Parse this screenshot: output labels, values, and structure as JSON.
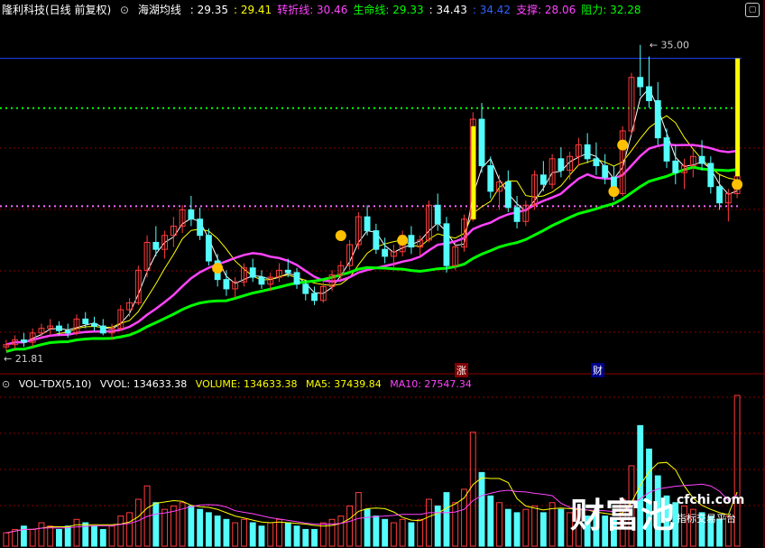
{
  "header": {
    "stock_title": "隆利科技(日线 前复权)",
    "indicator_name": "海湖均线",
    "values": [
      {
        "label": "",
        "value": "29.35",
        "color": "#ffffff"
      },
      {
        "label": "",
        "value": "29.41",
        "color": "#ffff00"
      },
      {
        "label": "转折线",
        "value": "30.46",
        "color": "#ff44ff"
      },
      {
        "label": "生命线",
        "value": "29.33",
        "color": "#00ff00"
      },
      {
        "label": "",
        "value": "34.43",
        "color": "#ffffff"
      },
      {
        "label": "",
        "value": "34.42",
        "color": "#3060ff"
      },
      {
        "label": "支撑",
        "value": "28.06",
        "color": "#ff44ff"
      },
      {
        "label": "阻力",
        "value": "32.28",
        "color": "#00ff00"
      }
    ]
  },
  "volume_header": {
    "name": "VOL-TDX(5,10)",
    "vvol": "VVOL: 134633.38",
    "volume": "VOLUME: 134633.38",
    "ma5": "MA5: 37439.84",
    "ma10": "MA10: 27547.34"
  },
  "annotations": {
    "high_label": "35.00",
    "low_label": "21.81",
    "tag_zhang": "涨",
    "tag_cai": "财"
  },
  "watermark": {
    "brand": "财富池",
    "site": "cfchi.com",
    "slogan": "指标交易平台"
  },
  "colors": {
    "up": "#ff3c3c",
    "down": "#54fcfc",
    "ma_white": "#ffffff",
    "ma_yellow": "#ffff00",
    "turn_line": "#ff44ff",
    "life_line": "#00ff00",
    "resistance_blue": "#2040ff",
    "grid": "#8b0000"
  },
  "chart_data": {
    "type": "candlestick",
    "price_range": [
      21,
      36
    ],
    "high": 35.0,
    "low": 21.81,
    "levels": {
      "blue_line": 34.42,
      "green_dotted": 32.28,
      "pink_dotted": 28.06
    },
    "candles_ohlc": [
      [
        22.0,
        22.3,
        21.81,
        22.1
      ],
      [
        22.1,
        22.5,
        21.9,
        22.3
      ],
      [
        22.3,
        22.6,
        22.0,
        22.2
      ],
      [
        22.2,
        22.8,
        22.0,
        22.6
      ],
      [
        22.6,
        23.0,
        22.4,
        22.8
      ],
      [
        22.8,
        23.2,
        22.5,
        22.9
      ],
      [
        22.9,
        23.1,
        22.5,
        22.7
      ],
      [
        22.7,
        23.0,
        22.4,
        22.6
      ],
      [
        22.6,
        23.4,
        22.5,
        23.2
      ],
      [
        23.2,
        23.5,
        22.8,
        23.0
      ],
      [
        23.0,
        23.3,
        22.7,
        22.9
      ],
      [
        22.9,
        23.2,
        22.5,
        22.6
      ],
      [
        22.6,
        23.0,
        22.3,
        22.8
      ],
      [
        22.8,
        23.8,
        22.7,
        23.6
      ],
      [
        23.6,
        24.1,
        23.3,
        23.9
      ],
      [
        23.9,
        25.5,
        23.8,
        25.3
      ],
      [
        25.3,
        26.8,
        25.0,
        26.5
      ],
      [
        26.5,
        27.2,
        25.9,
        26.2
      ],
      [
        26.2,
        27.0,
        25.8,
        26.8
      ],
      [
        26.8,
        27.6,
        26.3,
        27.2
      ],
      [
        27.2,
        28.1,
        26.9,
        27.9
      ],
      [
        27.9,
        28.5,
        27.2,
        27.5
      ],
      [
        27.5,
        28.0,
        26.6,
        26.8
      ],
      [
        26.8,
        27.1,
        25.5,
        25.7
      ],
      [
        25.7,
        26.0,
        24.6,
        24.9
      ],
      [
        24.9,
        25.3,
        24.2,
        24.5
      ],
      [
        24.5,
        25.0,
        24.1,
        24.8
      ],
      [
        24.8,
        25.6,
        24.6,
        25.4
      ],
      [
        25.4,
        25.8,
        24.8,
        25.0
      ],
      [
        25.0,
        25.3,
        24.5,
        24.7
      ],
      [
        24.7,
        25.2,
        24.4,
        25.0
      ],
      [
        25.0,
        25.6,
        24.8,
        25.3
      ],
      [
        25.3,
        25.8,
        25.0,
        25.2
      ],
      [
        25.2,
        25.4,
        24.5,
        24.7
      ],
      [
        24.7,
        24.9,
        24.0,
        24.3
      ],
      [
        24.3,
        24.6,
        23.8,
        24.0
      ],
      [
        24.0,
        24.8,
        23.9,
        24.6
      ],
      [
        24.6,
        25.3,
        24.4,
        25.1
      ],
      [
        25.1,
        25.7,
        24.9,
        25.5
      ],
      [
        25.5,
        26.6,
        25.3,
        26.4
      ],
      [
        26.4,
        27.8,
        26.2,
        27.6
      ],
      [
        27.6,
        28.1,
        26.8,
        27.0
      ],
      [
        27.0,
        27.3,
        26.0,
        26.2
      ],
      [
        26.2,
        26.7,
        25.6,
        25.9
      ],
      [
        25.9,
        26.4,
        25.4,
        26.1
      ],
      [
        26.1,
        27.0,
        25.9,
        26.8
      ],
      [
        26.8,
        27.2,
        26.0,
        26.3
      ],
      [
        26.3,
        26.8,
        25.9,
        26.6
      ],
      [
        26.6,
        28.3,
        26.5,
        28.1
      ],
      [
        28.1,
        28.6,
        27.0,
        27.3
      ],
      [
        27.3,
        27.6,
        25.2,
        25.5
      ],
      [
        25.5,
        26.5,
        25.3,
        26.3
      ],
      [
        26.3,
        27.7,
        26.1,
        27.5
      ],
      [
        27.5,
        32.1,
        27.4,
        31.8
      ],
      [
        31.8,
        32.5,
        29.5,
        29.8
      ],
      [
        29.8,
        30.2,
        28.4,
        28.7
      ],
      [
        28.7,
        29.4,
        27.9,
        29.1
      ],
      [
        29.1,
        29.6,
        27.8,
        28.0
      ],
      [
        28.0,
        28.5,
        27.1,
        27.4
      ],
      [
        27.4,
        28.3,
        27.2,
        28.1
      ],
      [
        28.1,
        29.6,
        27.9,
        29.4
      ],
      [
        29.4,
        30.0,
        28.7,
        29.0
      ],
      [
        29.0,
        30.3,
        28.8,
        30.1
      ],
      [
        30.1,
        30.6,
        29.3,
        29.6
      ],
      [
        29.6,
        30.4,
        29.2,
        30.2
      ],
      [
        30.2,
        31.0,
        29.8,
        30.7
      ],
      [
        30.7,
        31.2,
        29.9,
        30.1
      ],
      [
        30.1,
        30.8,
        29.4,
        29.8
      ],
      [
        29.8,
        30.3,
        29.0,
        29.3
      ],
      [
        29.3,
        29.8,
        28.3,
        28.6
      ],
      [
        28.6,
        31.5,
        28.5,
        31.3
      ],
      [
        31.3,
        33.8,
        31.1,
        33.6
      ],
      [
        33.6,
        35.0,
        32.8,
        33.2
      ],
      [
        33.2,
        34.5,
        32.3,
        32.6
      ],
      [
        32.6,
        33.4,
        30.7,
        31.0
      ],
      [
        31.0,
        31.4,
        29.7,
        30.0
      ],
      [
        30.0,
        30.7,
        29.0,
        29.5
      ],
      [
        29.5,
        30.1,
        28.8,
        29.8
      ],
      [
        29.8,
        30.5,
        29.3,
        30.2
      ],
      [
        30.2,
        30.9,
        29.6,
        29.9
      ],
      [
        29.9,
        30.2,
        28.6,
        28.9
      ],
      [
        28.9,
        29.4,
        27.9,
        28.2
      ],
      [
        28.2,
        28.8,
        27.4,
        28.6
      ],
      [
        28.6,
        29.7,
        28.4,
        29.35
      ]
    ],
    "volumes": [
      4,
      5,
      6,
      5,
      7,
      6,
      5,
      6,
      8,
      7,
      6,
      5,
      6,
      9,
      10,
      14,
      18,
      13,
      11,
      12,
      13,
      12,
      11,
      10,
      9,
      8,
      7,
      8,
      7,
      6,
      7,
      8,
      7,
      6,
      5,
      5,
      7,
      8,
      9,
      12,
      16,
      11,
      9,
      8,
      7,
      8,
      7,
      8,
      14,
      12,
      16,
      13,
      17,
      34,
      22,
      15,
      13,
      11,
      10,
      11,
      12,
      10,
      13,
      11,
      10,
      11,
      9,
      10,
      9,
      8,
      14,
      24,
      36,
      29,
      21,
      15,
      13,
      12,
      11,
      10,
      9,
      8,
      9,
      45
    ]
  }
}
